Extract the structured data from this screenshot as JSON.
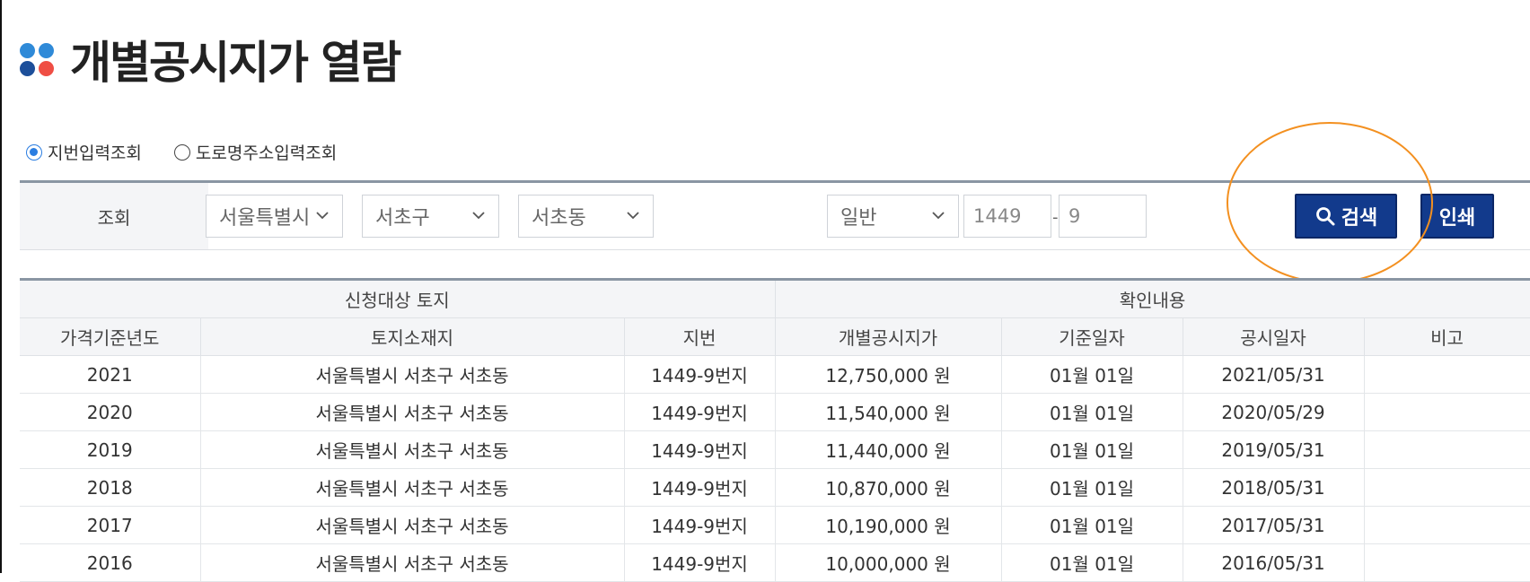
{
  "page": {
    "title": "개별공시지가 열람"
  },
  "colors": {
    "accent": "#123a8c",
    "radio_on": "#2a7de1",
    "annotation": "#f39020",
    "dot_blue": "#2f8ad8",
    "dot_navy": "#1d4f9a",
    "dot_red": "#ef4e44"
  },
  "search_type": {
    "options": [
      {
        "label": "지번입력조회",
        "selected": true
      },
      {
        "label": "도로명주소입력조회",
        "selected": false
      }
    ]
  },
  "search": {
    "label": "조회",
    "city": "서울특별시",
    "district": "서초구",
    "dong": "서초동",
    "lot_type": "일반",
    "main_number": "1449",
    "sub_number": "9",
    "separator": "-",
    "search_button": "검색",
    "print_button": "인쇄"
  },
  "table": {
    "group_headers": [
      "신청대상 토지",
      "확인내용"
    ],
    "columns": [
      "가격기준년도",
      "토지소재지",
      "지번",
      "개별공시지가",
      "기준일자",
      "공시일자",
      "비고"
    ],
    "rows": [
      [
        "2021",
        "서울특별시 서초구 서초동",
        "1449-9번지",
        "12,750,000 원",
        "01월 01일",
        "2021/05/31",
        ""
      ],
      [
        "2020",
        "서울특별시 서초구 서초동",
        "1449-9번지",
        "11,540,000 원",
        "01월 01일",
        "2020/05/29",
        ""
      ],
      [
        "2019",
        "서울특별시 서초구 서초동",
        "1449-9번지",
        "11,440,000 원",
        "01월 01일",
        "2019/05/31",
        ""
      ],
      [
        "2018",
        "서울특별시 서초구 서초동",
        "1449-9번지",
        "10,870,000 원",
        "01월 01일",
        "2018/05/31",
        ""
      ],
      [
        "2017",
        "서울특별시 서초구 서초동",
        "1449-9번지",
        "10,190,000 원",
        "01월 01일",
        "2017/05/31",
        ""
      ],
      [
        "2016",
        "서울특별시 서초구 서초동",
        "1449-9번지",
        "10,000,000 원",
        "01월 01일",
        "2016/05/31",
        ""
      ]
    ]
  }
}
